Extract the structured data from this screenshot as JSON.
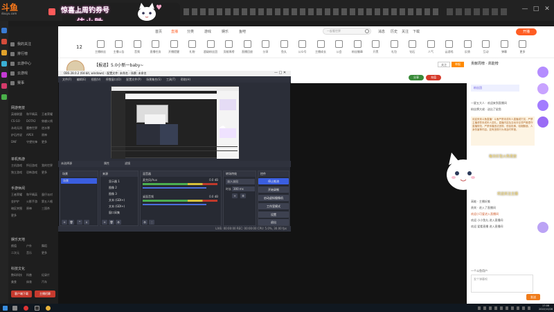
{
  "browser": {
    "tab_title": "惊喜上周钓券号",
    "tab2": "斗鱼直播",
    "window_controls": [
      "—",
      "□",
      "✕"
    ]
  },
  "site": {
    "logo": "斗鱼",
    "logo_sub": "douyu.com",
    "banner_top": "惊喜上周钓券号",
    "banner_bottom": "佳小胜",
    "nav": [
      "首页",
      "直播",
      "分类",
      "游戏",
      "娱乐",
      "鱼吧"
    ],
    "search_placeholder": "一起看世界",
    "header_right": [
      "消息",
      "历史",
      "关注",
      "下载",
      "开播"
    ]
  },
  "sidebar": {
    "items": [
      "我的关注",
      "排行榜",
      "云游中心",
      "云游戏",
      "赛事"
    ],
    "section1_title": "网游竞技",
    "section1": [
      "英雄联盟",
      "和平精英",
      "王者荣耀",
      "CS:GO",
      "DOTA2",
      "穿越火线",
      "永劫无间",
      "魔兽世界",
      "逆水寒",
      "炉石传说",
      "APEX",
      "原神",
      "DNF",
      "守望先锋",
      "更多"
    ],
    "section2_title": "单机热游",
    "section2": [
      "主机游戏",
      "怀旧游戏",
      "我的世界",
      "独立游戏",
      "恐怖游戏",
      "更多"
    ],
    "section3_title": "手游休闲",
    "section3": [
      "王者荣耀",
      "和平精英",
      "蛋仔派对",
      "金铲铲",
      "火影手游",
      "第五人格",
      "暗区突围",
      "原神",
      "三国杀",
      "更多"
    ],
    "section4_title": "娱乐天地",
    "section4": [
      "颜值",
      "户外",
      "舞蹈",
      "二次元",
      "音乐",
      "更多"
    ],
    "section5_title": "科技文化",
    "section5": [
      "数码科技",
      "科普",
      "纪录片",
      "美食",
      "体育",
      "汽车"
    ],
    "btn_left": "客户端下载",
    "btn_right": "主播招募"
  },
  "toolbar": [
    "主播粉丝",
    "主播公告",
    "音频",
    "直播任务",
    "开播提醒",
    "礼物",
    "超级粉丝团",
    "贡献周榜",
    "直播回放",
    "分享",
    "鱼丸",
    "公众号",
    "主播成长",
    "公会",
    "粉丝徽章",
    "开黑",
    "礼包",
    "钻石",
    "人气",
    "云游戏",
    "反馈",
    "互动",
    "弹幕",
    "更多"
  ],
  "toolbar_count": "12",
  "room": {
    "title": "【报道】5.0小新一baby~",
    "subinfo": "佳小胜 · 二次元 · 视频 · 房间号 · 直播中",
    "btn_follow": "关注",
    "btn_report": "举报",
    "btn_share": "分享",
    "btn_charge": "充值"
  },
  "obs": {
    "title": "OBS 28.0.2 (64-bit, windows) - 配置文件: 未命名 - 场景: 未命名",
    "menu": [
      "文件(F)",
      "编辑(E)",
      "视图(V)",
      "停靠窗口(D)",
      "配置文件(P)",
      "场景集合(S)",
      "工具(T)",
      "帮助(H)"
    ],
    "tabs": [
      "属性",
      "滤镜"
    ],
    "no_source": "未选择源",
    "docks": {
      "scenes": "场景",
      "sources": "来源",
      "mixer": "混音器",
      "transitions": "转场特效",
      "controls": "控件"
    },
    "scene_item": "场景",
    "sources": [
      "显示器 1",
      "图像 2",
      "图像 3",
      "文本 (GDI+)",
      "文本 (GDI+)",
      "窗口采集"
    ],
    "mixer": [
      {
        "name": "麦克风/Aux",
        "db": "0.0 dB"
      },
      {
        "name": "桌面音频",
        "db": "0.0 dB"
      }
    ],
    "transition": "淡入淡出",
    "duration_label": "时长",
    "duration_value": "300 ms",
    "controls": [
      "停止推流",
      "开始录制",
      "启动虚拟摄像机",
      "工作室模式",
      "设置",
      "退出"
    ],
    "status": "LIVE: 00:00:00   REC: 00:00:00   CPU: 5.0%, 30.00 fps"
  },
  "right_panel": {
    "header": "贡献周榜 · 高能榜",
    "fans": "粉丝团",
    "chat": [
      "一星五大人 · 欢迎来到直播间",
      "粉丝牌大佬 · 送出了鲨鱼",
      "高能 · 主播好美",
      "贵宾 · 进入了直播间",
      "欢迎小可爱进入直播间",
      "欢迎 小小鱼丸 进入直播间",
      "欢迎 爱看直播 进入直播间"
    ],
    "notice": "欢迎来到斗鱼直播！斗鱼严禁未成年人直播或打赏，严禁主播诱导未成年人送礼。直播内容及互动评论须严格遵守直播规范，严禁传播违法违规、低俗色情、吸烟酗酒、人身伤害等内容。如有违规行为请及时举报。",
    "overlay_text1": "每日红包火热发放",
    "overlay_text2": "欢迎关注主播",
    "input_placeholder": "发个弹幕呗",
    "send": "发送",
    "user": "一个斗鱼用户"
  },
  "taskbar": {
    "time": "17:06",
    "date": "2022/10/28"
  }
}
